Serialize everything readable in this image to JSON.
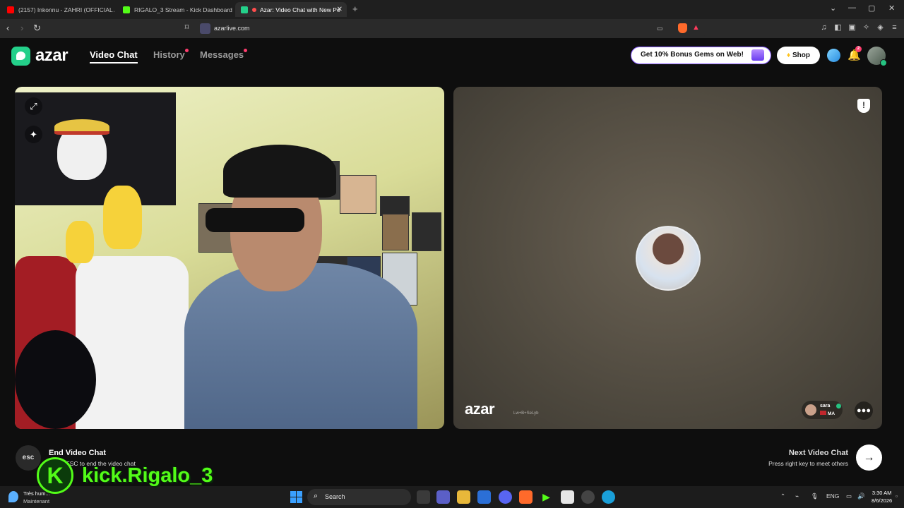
{
  "browser": {
    "tabs": [
      {
        "label": "(2157) Inkonnu - ZAHRI (OFFICIAL AI",
        "favicon_color": "#ff0000"
      },
      {
        "label": "RIGALO_3 Stream - Kick Dashboard",
        "favicon_color": "#53fc18"
      },
      {
        "label": "Azar: Video Chat with New Pe",
        "favicon_color": "#24d08a"
      }
    ],
    "url": "azarlive.com"
  },
  "header": {
    "brand": "azar",
    "nav": [
      {
        "label": "Video Chat",
        "active": true
      },
      {
        "label": "History",
        "active": false,
        "dot": true
      },
      {
        "label": "Messages",
        "active": false,
        "dot": true
      }
    ],
    "promo_label": "Get 10% Bonus Gems on Web!",
    "shop_label": "Shop",
    "notification_count": "2"
  },
  "partner": {
    "name": "sara",
    "country": "MA",
    "watermark": "azar",
    "watermark_id": "Lw+B+SeLyb"
  },
  "footer": {
    "esc_label": "esc",
    "end_title": "End Video Chat",
    "end_sub": "Press ESC to end the video chat",
    "next_title": "Next Video Chat",
    "next_sub": "Press right key to meet others"
  },
  "overlay": {
    "kick_handle": "kick.Rigalo_3"
  },
  "taskbar": {
    "weather_l1": "Très hum...",
    "weather_l2": "Maintenant",
    "search_label": "Search",
    "lang": "ENG",
    "time": "3:30 AM",
    "date": "8/6/2026"
  },
  "colors": {
    "accent": "#24d08a",
    "kick": "#53fc18",
    "dot": "#ff3d6e"
  }
}
